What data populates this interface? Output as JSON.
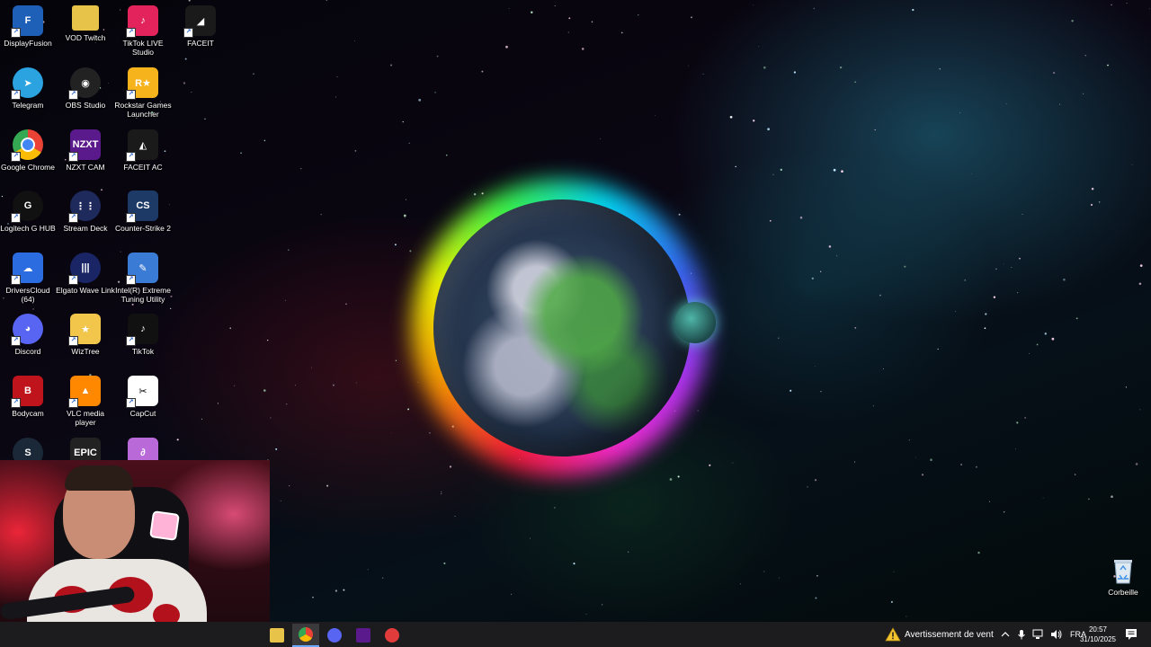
{
  "desktop": {
    "icons": [
      {
        "label": "DisplayFusion",
        "icon": "displayfusion-icon",
        "bg": "#1e5fb8",
        "glyph": "F"
      },
      {
        "label": "Telegram",
        "icon": "telegram-icon",
        "bg": "#2aa3e0",
        "glyph": "➤"
      },
      {
        "label": "Google Chrome",
        "icon": "chrome-icon",
        "bg": "#ea4335",
        "glyph": ""
      },
      {
        "label": "Logitech G HUB",
        "icon": "logitech-icon",
        "bg": "#111111",
        "glyph": "G"
      },
      {
        "label": "DriversCloud (64)",
        "icon": "driverscloud-icon",
        "bg": "#2b6de0",
        "glyph": "☁"
      },
      {
        "label": "Discord",
        "icon": "discord-icon",
        "bg": "#5865f2",
        "glyph": "◕"
      },
      {
        "label": "Bodycam",
        "icon": "bodycam-icon",
        "bg": "#c0141c",
        "glyph": "B"
      },
      {
        "label": "",
        "icon": "steam-icon",
        "bg": "#1b2838",
        "glyph": "S"
      },
      {
        "label": "VOD Twitch",
        "icon": "folder-icon",
        "bg": "#e8c34a",
        "glyph": ""
      },
      {
        "label": "OBS Studio",
        "icon": "obs-icon",
        "bg": "#222222",
        "glyph": "◉"
      },
      {
        "label": "NZXT CAM",
        "icon": "nzxt-icon",
        "bg": "#5a1a8c",
        "glyph": "NZXT"
      },
      {
        "label": "Stream Deck",
        "icon": "streamdeck-icon",
        "bg": "#1f2a5c",
        "glyph": "⋮⋮"
      },
      {
        "label": "Elgato Wave Link",
        "icon": "wavelink-icon",
        "bg": "#1a2566",
        "glyph": "|||"
      },
      {
        "label": "WizTree",
        "icon": "wiztree-icon",
        "bg": "#f2c64a",
        "glyph": "★"
      },
      {
        "label": "VLC media player",
        "icon": "vlc-icon",
        "bg": "#ff8800",
        "glyph": "▲"
      },
      {
        "label": "",
        "icon": "epic-games-icon",
        "bg": "#222222",
        "glyph": "EPIC"
      },
      {
        "label": "TikTok LIVE Studio",
        "icon": "tiktok-live-icon",
        "bg": "#e3245c",
        "glyph": "♪"
      },
      {
        "label": "Rockstar Games Launcher",
        "icon": "rockstar-icon",
        "bg": "#f6b31b",
        "glyph": "R★"
      },
      {
        "label": "FACEIT AC",
        "icon": "faceit-ac-icon",
        "bg": "#1a1a1a",
        "glyph": "◭"
      },
      {
        "label": "Counter-Strike 2",
        "icon": "cs2-icon",
        "bg": "#1d3a66",
        "glyph": "CS"
      },
      {
        "label": "Intel(R) Extreme Tuning Utility",
        "icon": "intel-xtu-icon",
        "bg": "#3a7bd5",
        "glyph": "✎"
      },
      {
        "label": "TikTok",
        "icon": "tiktok-icon",
        "bg": "#111111",
        "glyph": "♪"
      },
      {
        "label": "CapCut",
        "icon": "capcut-icon",
        "bg": "#ffffff",
        "glyph": "✂"
      },
      {
        "label": "",
        "icon": "app-icon",
        "bg": "#b96ad8",
        "glyph": "∂"
      },
      {
        "label": "FACEIT",
        "icon": "faceit-icon",
        "bg": "#1a1a1a",
        "glyph": "◢"
      }
    ],
    "recycle_bin": {
      "label": "Corbeille",
      "icon": "recycle-bin-icon"
    }
  },
  "taskbar": {
    "apps": [
      {
        "name": "file-explorer",
        "icon": "folder-icon",
        "color": "#e8c34a"
      },
      {
        "name": "chrome",
        "icon": "chrome-icon",
        "color": "#ea4335",
        "active": true
      },
      {
        "name": "discord",
        "icon": "discord-icon",
        "color": "#5865f2"
      },
      {
        "name": "nzxt-cam",
        "icon": "nzxt-icon",
        "color": "#5a1a8c"
      },
      {
        "name": "speedometer",
        "icon": "speedometer-icon",
        "color": "#e23b3b"
      }
    ],
    "weather": {
      "text": "Avertissement de vent",
      "icon": "warning-icon",
      "color": "#f4c430"
    },
    "tray": {
      "language": "FRA",
      "icons": [
        "chevron-up-icon",
        "microphone-icon",
        "network-icon",
        "volume-icon"
      ]
    },
    "clock": {
      "time": "20:57",
      "date": "31/10/2025"
    }
  }
}
